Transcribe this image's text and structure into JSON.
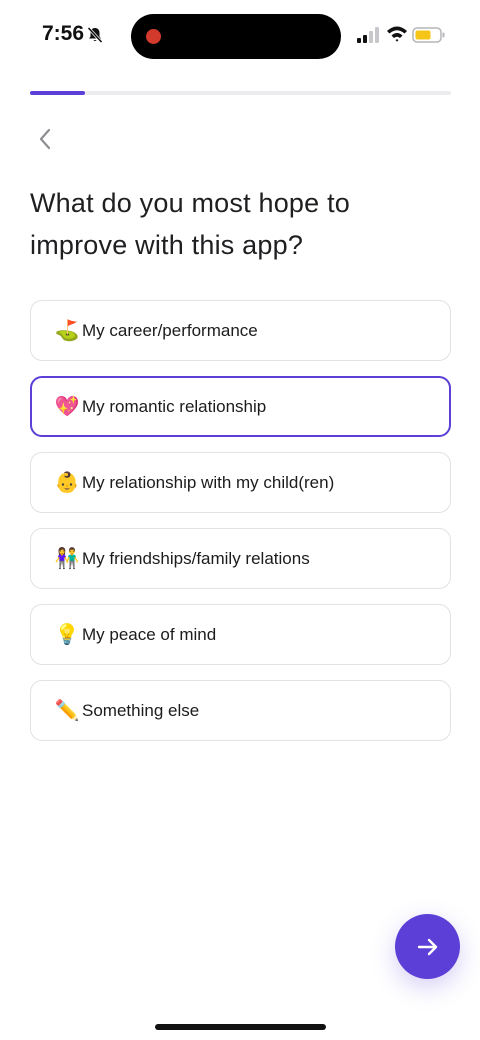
{
  "status_bar": {
    "time": "7:56",
    "icons": [
      "bell-slash-icon",
      "cellular-signal-icon",
      "wifi-icon",
      "battery-icon"
    ],
    "battery_color": "#f5c518"
  },
  "progress": {
    "fraction": 0.13,
    "color": "#5b3fd6"
  },
  "header": {
    "back_icon": "chevron-left-icon"
  },
  "question": {
    "title": "What do you most hope to improve with this app?"
  },
  "options": [
    {
      "emoji": "⛳",
      "label": "My career/performance",
      "selected": false
    },
    {
      "emoji": "💖",
      "label": "My romantic relationship",
      "selected": true
    },
    {
      "emoji": "👶",
      "label": "My relationship with my child(ren)",
      "selected": false
    },
    {
      "emoji": "👫",
      "label": "My friendships/family relations",
      "selected": false
    },
    {
      "emoji": "💡",
      "label": "My peace of mind",
      "selected": false
    },
    {
      "emoji": "✏️",
      "label": "Something else",
      "selected": false
    }
  ],
  "next_button": {
    "icon": "arrow-right-icon",
    "color": "#5b3fd6"
  }
}
